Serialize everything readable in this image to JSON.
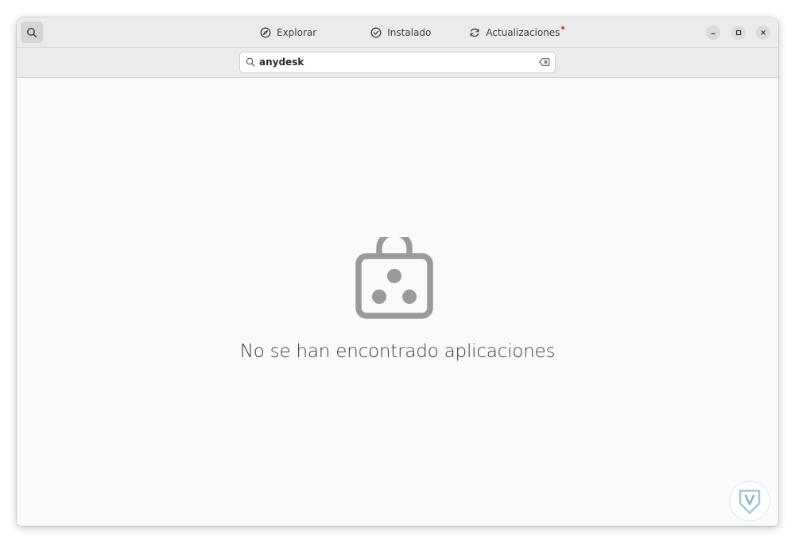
{
  "header": {
    "search_toggle_icon": "search-icon",
    "tabs": [
      {
        "label": "Explorar",
        "icon": "compass-icon"
      },
      {
        "label": "Instalado",
        "icon": "check-circle-icon"
      },
      {
        "label": "Actualizaciones",
        "icon": "refresh-icon",
        "has_notification": true
      }
    ],
    "window_controls": [
      "minimize-icon",
      "maximize-icon",
      "close-icon"
    ]
  },
  "search": {
    "value": "anydesk",
    "clear_icon": "backspace-icon"
  },
  "empty_state": {
    "icon": "app-store-bag-icon",
    "message": "No se han encontrado aplicaciones"
  },
  "colors": {
    "headerbar": "#ebebeb",
    "content_bg": "#fafafa",
    "notification_dot": "#c0561c",
    "empty_icon": "#9a9a9a"
  }
}
